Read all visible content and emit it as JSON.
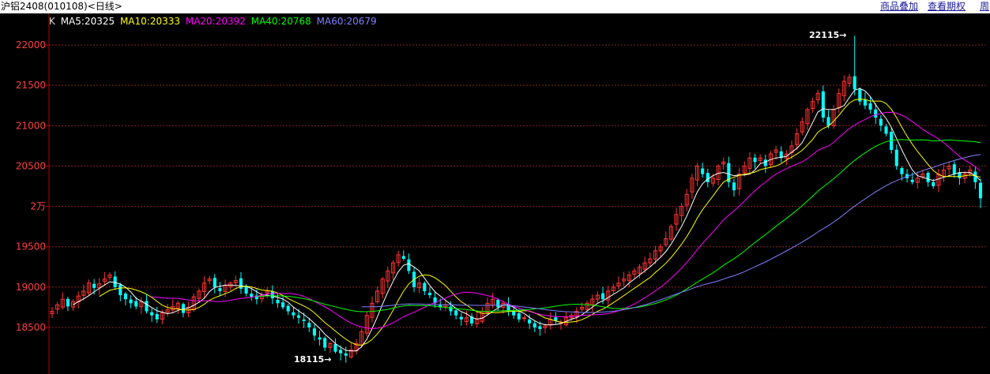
{
  "header": {
    "title": "沪铝2408(010108)<日线>",
    "links": [
      "商品叠加",
      "查看期权",
      "周"
    ]
  },
  "legend": {
    "prefix": "K",
    "items": [
      {
        "label": "MA5:20325",
        "color": "#ffffff"
      },
      {
        "label": "MA10:20333",
        "color": "#ffff00"
      },
      {
        "label": "MA20:20392",
        "color": "#ff00ff"
      },
      {
        "label": "MA40:20768",
        "color": "#00ff00"
      },
      {
        "label": "MA60:20679",
        "color": "#8080ff"
      }
    ]
  },
  "colors": {
    "up": "#ff3333",
    "down": "#00ffff",
    "grid": "#882222",
    "axis": "#b40000"
  },
  "annotations": {
    "high": "22115→",
    "low": "18115→"
  },
  "chart_data": {
    "type": "candlestick",
    "y_ticks": [
      18500,
      19000,
      19500,
      20000,
      20500,
      21000,
      21500,
      22000
    ],
    "y_tick_labels": [
      "18500",
      "19000",
      "19500",
      "2万",
      "20500",
      "21000",
      "21500",
      "22000"
    ],
    "ylim": [
      17950,
      22300
    ],
    "grid": true,
    "high": 22115,
    "low": 18115,
    "close": [
      18700,
      18780,
      18850,
      18760,
      18820,
      18890,
      18950,
      19050,
      18990,
      19040,
      19100,
      19150,
      19000,
      18900,
      18850,
      18800,
      18760,
      18820,
      18700,
      18650,
      18600,
      18680,
      18720,
      18760,
      18800,
      18680,
      18750,
      18880,
      18950,
      19050,
      19100,
      19000,
      18950,
      19020,
      19050,
      19080,
      18980,
      18920,
      18880,
      18850,
      18900,
      18950,
      18860,
      18800,
      18750,
      18700,
      18650,
      18620,
      18580,
      18500,
      18400,
      18350,
      18250,
      18300,
      18200,
      18180,
      18150,
      18220,
      18300,
      18450,
      18650,
      18800,
      18950,
      19100,
      19200,
      19300,
      19400,
      19350,
      19200,
      19000,
      19050,
      18950,
      18900,
      18800,
      18750,
      18780,
      18700,
      18650,
      18600,
      18620,
      18550,
      18600,
      18700,
      18800,
      18850,
      18750,
      18800,
      18700,
      18650,
      18600,
      18620,
      18550,
      18500,
      18480,
      18520,
      18600,
      18580,
      18560,
      18620,
      18650,
      18700,
      18750,
      18800,
      18850,
      18900,
      18850,
      18950,
      19000,
      19050,
      19100,
      19150,
      19200,
      19250,
      19300,
      19350,
      19450,
      19500,
      19600,
      19750,
      19900,
      20000,
      20150,
      20350,
      20500,
      20400,
      20300,
      20350,
      20500,
      20550,
      20300,
      20200,
      20400,
      20500,
      20600,
      20550,
      20600,
      20500,
      20650,
      20700,
      20600,
      20650,
      20750,
      20900,
      21050,
      21200,
      21300,
      21400,
      21100,
      21000,
      21200,
      21400,
      21550,
      21600,
      21450,
      21300,
      21250,
      21200,
      21100,
      21000,
      20900,
      20700,
      20500,
      20400,
      20350,
      20300,
      20350,
      20400,
      20300,
      20250,
      20400,
      20450,
      20500,
      20400,
      20350,
      20400,
      20450,
      20300,
      20100
    ]
  }
}
